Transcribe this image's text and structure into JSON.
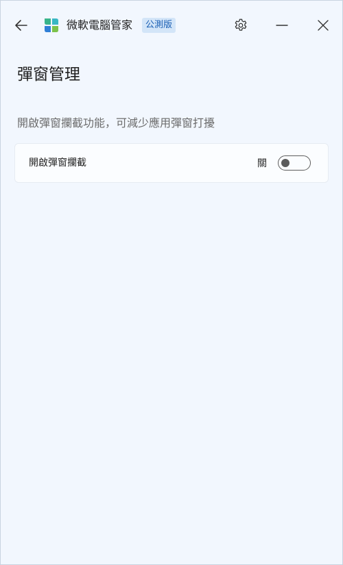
{
  "titlebar": {
    "app_name": "微軟電腦管家",
    "badge": "公測版",
    "back_icon": "arrow-left-icon",
    "settings_icon": "gear-icon",
    "minimize_icon": "minimize-icon",
    "close_icon": "close-icon"
  },
  "page": {
    "title": "彈窗管理",
    "description": "開啟彈窗攔截功能，可減少應用彈窗打擾"
  },
  "setting": {
    "label": "開啟彈窗攔截",
    "state_text": "關",
    "enabled": false
  },
  "colors": {
    "background": "#f2f7fe",
    "card": "#fbfdff",
    "badge_bg": "#d3e5f8",
    "badge_text": "#1a5fb4",
    "toggle_off": "#5c5c5c",
    "logo_green": "#38b48b",
    "logo_blue": "#2f7fd6",
    "logo_teal": "#39b7c4",
    "logo_lime": "#7cc24a"
  }
}
